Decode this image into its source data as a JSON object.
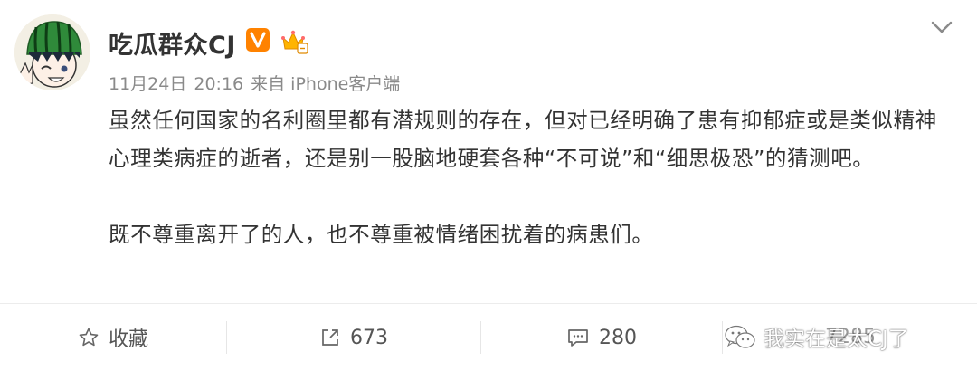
{
  "user": {
    "name": "吃瓜群众CJ"
  },
  "post": {
    "meta": {
      "date": "11月24日",
      "time": "20:16",
      "source": "来自 iPhone客户端"
    },
    "paragraphs": [
      "虽然任何国家的名利圈里都有潜规则的存在，但对已经明确了患有抑郁症或是类似精神心理类病症的逝者，还是别一股脑地硬套各种“不可说”和“细思极恐”的猜测吧。",
      "既不尊重离开了的人，也不尊重被情绪困扰着的病患们。"
    ]
  },
  "actions": {
    "favorite_label": "收藏",
    "repost_count": "673",
    "comment_count": "280",
    "like_count": "7285"
  },
  "watermark": {
    "text": "我实在是太CJ了"
  },
  "colors": {
    "vip_badge": "#ff8200",
    "text_primary": "#333333",
    "text_meta": "#8a8a8a"
  },
  "icons": [
    "avatar-image",
    "vip-badge-icon",
    "crown-badge-icon",
    "chevron-down-icon",
    "star-icon",
    "share-icon",
    "comment-icon",
    "wechat-icon"
  ]
}
